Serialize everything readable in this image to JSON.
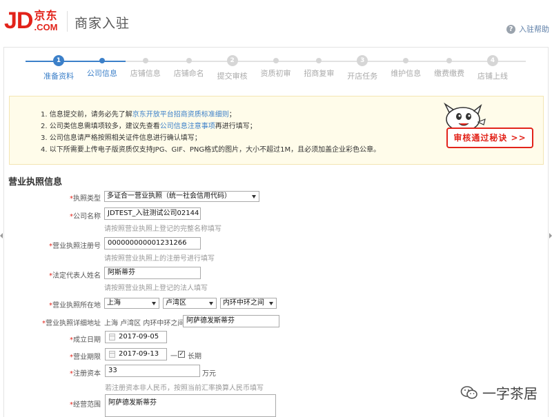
{
  "header": {
    "logo_jd": "JD",
    "logo_cn": "京东",
    "logo_com": ".COM",
    "title": "商家入驻",
    "help_label": "入驻帮助",
    "help_icon": "question-circle-icon"
  },
  "steps": [
    {
      "label": "准备资料",
      "number": "1",
      "state": "active",
      "type": "big"
    },
    {
      "label": "公司信息",
      "number": "",
      "state": "active",
      "type": "small"
    },
    {
      "label": "店铺信息",
      "number": "",
      "state": "inactive",
      "type": "small"
    },
    {
      "label": "店铺命名",
      "number": "",
      "state": "inactive",
      "type": "small"
    },
    {
      "label": "提交审核",
      "number": "2",
      "state": "inactive",
      "type": "big"
    },
    {
      "label": "资质初审",
      "number": "",
      "state": "inactive",
      "type": "small"
    },
    {
      "label": "招商复审",
      "number": "",
      "state": "inactive",
      "type": "small"
    },
    {
      "label": "开店任务",
      "number": "3",
      "state": "inactive",
      "type": "big"
    },
    {
      "label": "维护信息",
      "number": "",
      "state": "inactive",
      "type": "small"
    },
    {
      "label": "缴费缴费",
      "number": "",
      "state": "inactive",
      "type": "small"
    },
    {
      "label": "店铺上线",
      "number": "4",
      "state": "inactive",
      "type": "big"
    }
  ],
  "notice": {
    "line1_a": "1. 信息提交前，请务必先了解",
    "line1_link": "京东开放平台招商资质标准细则",
    "line1_b": "；",
    "line2_a": "2. 公司类信息需填项较多，建议先查看",
    "line2_link": "公司信息注意事项",
    "line2_b": "再进行填写；",
    "line3": "3. 公司信息请严格按照相关证件信息进行确认填写；",
    "line4": "4. 以下所需要上传电子版资质仅支持JPG、GIF、PNG格式的图片，大小不超过1M，且必须加盖企业彩色公章。",
    "tips_button": "审核通过秘诀 >>"
  },
  "section": {
    "title": "营业执照信息"
  },
  "form": {
    "license_type": {
      "label": "执照类型",
      "value": "多证合一营业执照（统一社会信用代码）"
    },
    "company_name": {
      "label": "公司名称",
      "value": "JDTEST_入驻测试公司02144",
      "hint": "请按照营业执照上登记的完整名称填写"
    },
    "reg_number": {
      "label": "营业执照注册号",
      "value": "000000000001231266",
      "hint": "请按照营业执照上的注册号进行填写"
    },
    "legal_rep": {
      "label": "法定代表人姓名",
      "value": "阿斯蒂芬",
      "hint": "请按照营业执照上登记的法人填写"
    },
    "location": {
      "label": "营业执照所在地",
      "province": "上海",
      "district": "卢湾区",
      "area": "内环中环之间"
    },
    "address": {
      "label": "营业执照详细地址",
      "prefix": "上海 卢湾区 内环中环之间",
      "value": "阿萨德发斯蒂芬"
    },
    "founded": {
      "label": "成立日期",
      "value": "2017-09-05"
    },
    "term": {
      "label": "营业期限",
      "value": "2017-09-13",
      "separator": "一",
      "long_term": "长期",
      "long_term_checked": true
    },
    "capital": {
      "label": "注册资本",
      "value": "33",
      "unit": "万元",
      "hint": "若注册资本非人民币，按照当前汇率换算人民币填写"
    },
    "scope": {
      "label": "经营范围",
      "value": "阿萨德发斯蒂芬"
    }
  },
  "watermark": {
    "text": "一字茶居",
    "icon": "wechat-icon"
  },
  "colors": {
    "brand_red": "#e2231a",
    "accent_blue": "#3c80c9",
    "notice_bg": "#fffcea"
  }
}
